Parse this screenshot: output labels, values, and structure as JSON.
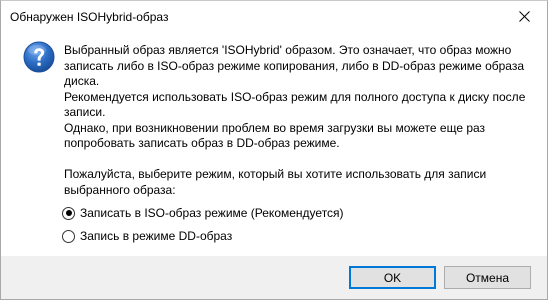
{
  "window": {
    "title": "Обнаружен ISOHybrid-образ"
  },
  "icons": {
    "question": "question-icon",
    "close": "close-icon"
  },
  "message": {
    "line1": "Выбранный образ является 'ISOHybrid' образом. Это означает, что образ можно",
    "line2": "записать либо в ISO-образ режиме копирования, либо в DD-образ режиме образа",
    "line3": "диска.",
    "line4": "Рекомендуется использовать ISO-образ режим для полного доступа к диску после",
    "line5": "записи.",
    "line6": "Однако, при возникновении проблем во время загрузки вы можете еще раз",
    "line7": "попробовать записать образ в DD-образ режиме.",
    "prompt1": "Пожалуйста, выберите режим, который вы хотите использовать для записи",
    "prompt2": "выбранного образа:"
  },
  "options": [
    {
      "label": "Записать в ISO-образ режиме (Рекомендуется)",
      "selected": true
    },
    {
      "label": "Запись в режиме DD-образ",
      "selected": false
    }
  ],
  "buttons": {
    "ok": "OK",
    "cancel": "Отмена"
  },
  "colors": {
    "accent": "#0078d7",
    "icon_blue": "#2b6cc4",
    "footer": "#f0f0f0"
  }
}
